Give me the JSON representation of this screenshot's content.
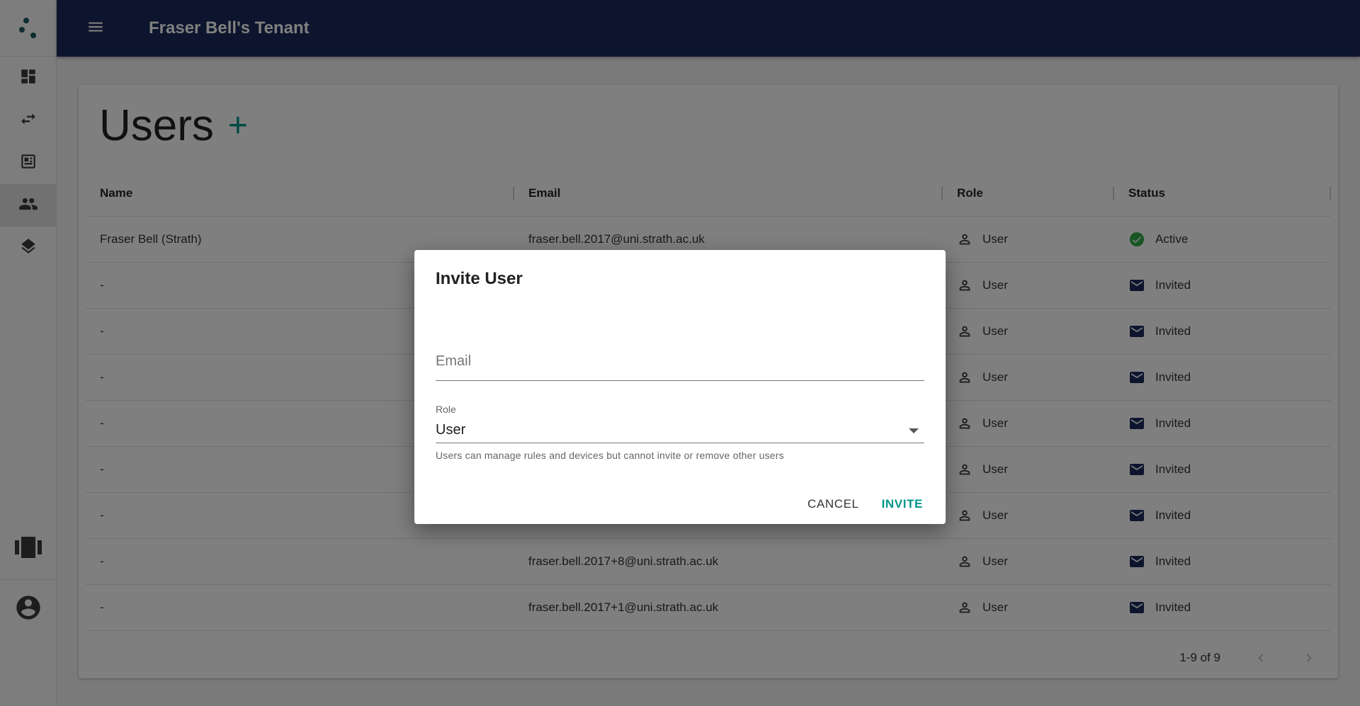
{
  "app": {
    "tenant_title": "Fraser Bell's Tenant"
  },
  "sidebar": {
    "items": [
      {
        "icon": "dashboard-icon"
      },
      {
        "icon": "swap-arrows-icon"
      },
      {
        "icon": "list-panel-icon"
      },
      {
        "icon": "people-icon",
        "active": true
      },
      {
        "icon": "layers-icon"
      }
    ],
    "bottom": [
      {
        "icon": "carousel-icon"
      },
      {
        "icon": "account-circle-icon"
      }
    ]
  },
  "page": {
    "title": "Users",
    "add_label": "+"
  },
  "table": {
    "columns": [
      "Name",
      "Email",
      "Role",
      "Status"
    ],
    "rows": [
      {
        "name": "Fraser Bell (Strath)",
        "email": "fraser.bell.2017@uni.strath.ac.uk",
        "role": "User",
        "status": "Active"
      },
      {
        "name": "-",
        "email": "",
        "role": "User",
        "status": "Invited"
      },
      {
        "name": "-",
        "email": "",
        "role": "User",
        "status": "Invited"
      },
      {
        "name": "-",
        "email": "",
        "role": "User",
        "status": "Invited"
      },
      {
        "name": "-",
        "email": "",
        "role": "User",
        "status": "Invited"
      },
      {
        "name": "-",
        "email": "",
        "role": "User",
        "status": "Invited"
      },
      {
        "name": "-",
        "email": "",
        "role": "User",
        "status": "Invited"
      },
      {
        "name": "-",
        "email": "fraser.bell.2017+8@uni.strath.ac.uk",
        "role": "User",
        "status": "Invited"
      },
      {
        "name": "-",
        "email": "fraser.bell.2017+1@uni.strath.ac.uk",
        "role": "User",
        "status": "Invited"
      }
    ],
    "pagination": "1-9 of 9"
  },
  "dialog": {
    "title": "Invite User",
    "email_placeholder": "Email",
    "email_value": "",
    "role_label": "Role",
    "role_value": "User",
    "helper_text": "Users can manage rules and devices but cannot invite or remove other users",
    "cancel_label": "CANCEL",
    "invite_label": "INVITE"
  },
  "colors": {
    "topbar": "#1b2a5c",
    "accent": "#009688",
    "active_status": "#2eaa4a",
    "invited_status": "#1b2a5c"
  }
}
